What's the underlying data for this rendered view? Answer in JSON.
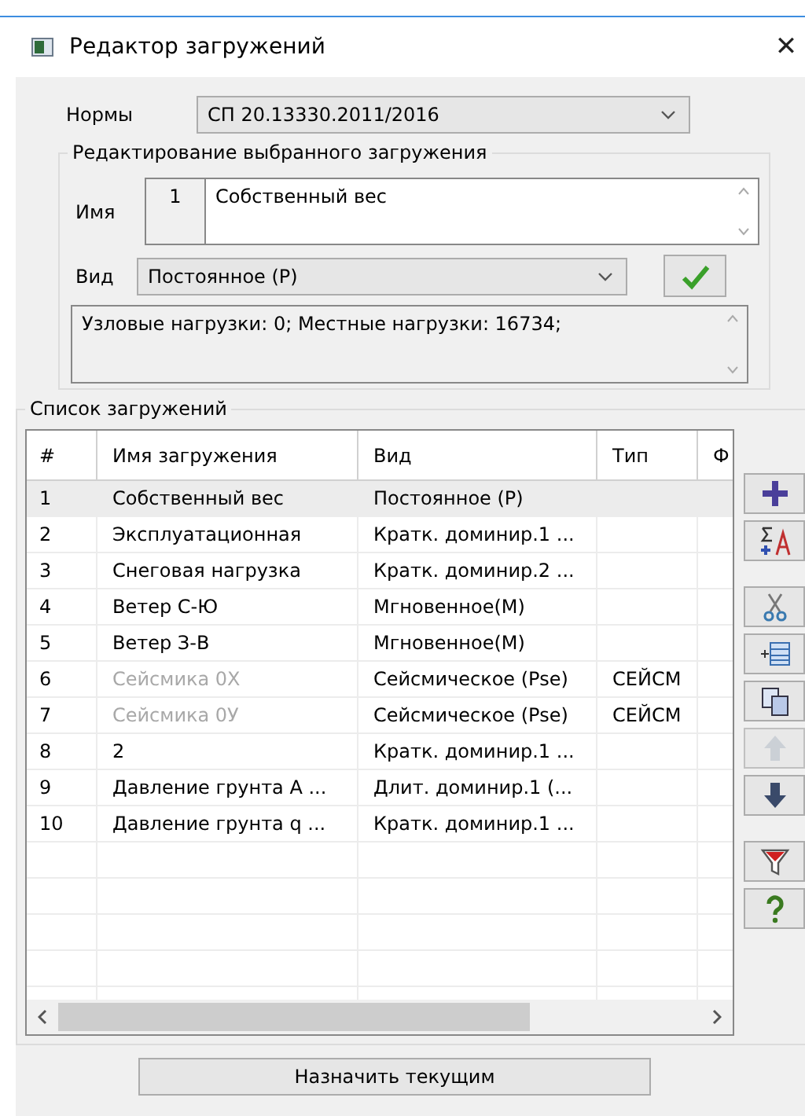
{
  "window": {
    "title": "Редактор загружений",
    "close": "✕"
  },
  "norms": {
    "label": "Нормы",
    "value": "СП 20.13330.2011/2016"
  },
  "edit_group": {
    "title": "Редактирование выбранного загружения",
    "name_label": "Имя",
    "number": "1",
    "name_value": "Собственный вес",
    "type_label": "Вид",
    "type_value": "Постоянное (P)",
    "info": "Узловые нагрузки:  0;  Местные нагрузки:  16734;"
  },
  "list_group": {
    "title": "Список загружений",
    "columns": [
      "#",
      "Имя загружения",
      "Вид",
      "Тип",
      "Ф"
    ],
    "rows": [
      {
        "cells": [
          "1",
          "Собственный вес",
          "Постоянное (P)",
          ""
        ],
        "selected": true,
        "disabled": false
      },
      {
        "cells": [
          "2",
          "Эксплуатационная",
          "Кратк. доминир.1 ...",
          ""
        ],
        "selected": false,
        "disabled": false
      },
      {
        "cells": [
          "3",
          "Снеговая нагрузка",
          "Кратк. доминир.2 ...",
          ""
        ],
        "selected": false,
        "disabled": false
      },
      {
        "cells": [
          "4",
          "Ветер С-Ю",
          "Мгновенное(M)",
          ""
        ],
        "selected": false,
        "disabled": false
      },
      {
        "cells": [
          "5",
          "Ветер З-В",
          "Мгновенное(M)",
          ""
        ],
        "selected": false,
        "disabled": false
      },
      {
        "cells": [
          "6",
          "Сейсмика 0X",
          "Сейсмическое (Pse)",
          "СЕЙСМ"
        ],
        "selected": false,
        "disabled": true
      },
      {
        "cells": [
          "7",
          "Сейсмика 0У",
          "Сейсмическое (Pse)",
          "СЕЙСМ"
        ],
        "selected": false,
        "disabled": true
      },
      {
        "cells": [
          "8",
          "2",
          "Кратк. доминир.1 ...",
          ""
        ],
        "selected": false,
        "disabled": false
      },
      {
        "cells": [
          "9",
          "Давление грунта А ...",
          "Длит. доминир.1 (...",
          ""
        ],
        "selected": false,
        "disabled": false
      },
      {
        "cells": [
          "10",
          "Давление грунта q ...",
          "Кратк. доминир.1 ...",
          ""
        ],
        "selected": false,
        "disabled": false
      }
    ],
    "tools": [
      {
        "kind": "add",
        "disabled": false
      },
      {
        "kind": "sum",
        "disabled": false
      },
      {
        "kind": "cut",
        "disabled": false
      },
      {
        "kind": "insert",
        "disabled": false
      },
      {
        "kind": "copy",
        "disabled": false
      },
      {
        "kind": "up",
        "disabled": true
      },
      {
        "kind": "down",
        "disabled": false
      },
      {
        "kind": "filter",
        "disabled": false
      },
      {
        "kind": "help",
        "disabled": false
      }
    ]
  },
  "assign_button": "Назначить текущим"
}
